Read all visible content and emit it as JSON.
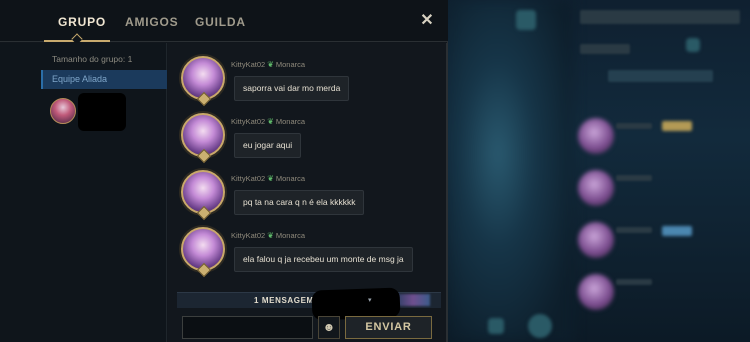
{
  "tabs": [
    {
      "label": "GRUPO",
      "active": true
    },
    {
      "label": "AMIGOS",
      "active": false
    },
    {
      "label": "GUILDA",
      "active": false
    }
  ],
  "close_icon_glyph": "✕",
  "group": {
    "size_text": "Tamanho do grupo: 1",
    "team_label": "Equipe Aliada"
  },
  "messages": [
    {
      "sender": "KittyKat02",
      "rank_icon": "rank-wings-icon",
      "rank": "Monarca",
      "text": "saporra vai dar mo merda"
    },
    {
      "sender": "KittyKat02",
      "rank_icon": "rank-wings-icon",
      "rank": "Monarca",
      "text": "eu jogar aqui"
    },
    {
      "sender": "KittyKat02",
      "rank_icon": "rank-wings-icon",
      "rank": "Monarca",
      "text": "pq ta na cara q n é ela kkkkkk"
    },
    {
      "sender": "KittyKat02",
      "rank_icon": "rank-wings-icon",
      "rank": "Monarca",
      "text": "ela falou q ja recebeu um monte de msg ja"
    }
  ],
  "unread_bar": {
    "text": "1 MENSAGEM"
  },
  "composer": {
    "input_value": "",
    "emoji_glyph": "☻",
    "send_label": "ENVIAR"
  },
  "colors": {
    "accent_gold": "#c8aa6e",
    "team_blue": "#1b3a5c",
    "rank_green": "#5fb96a"
  }
}
